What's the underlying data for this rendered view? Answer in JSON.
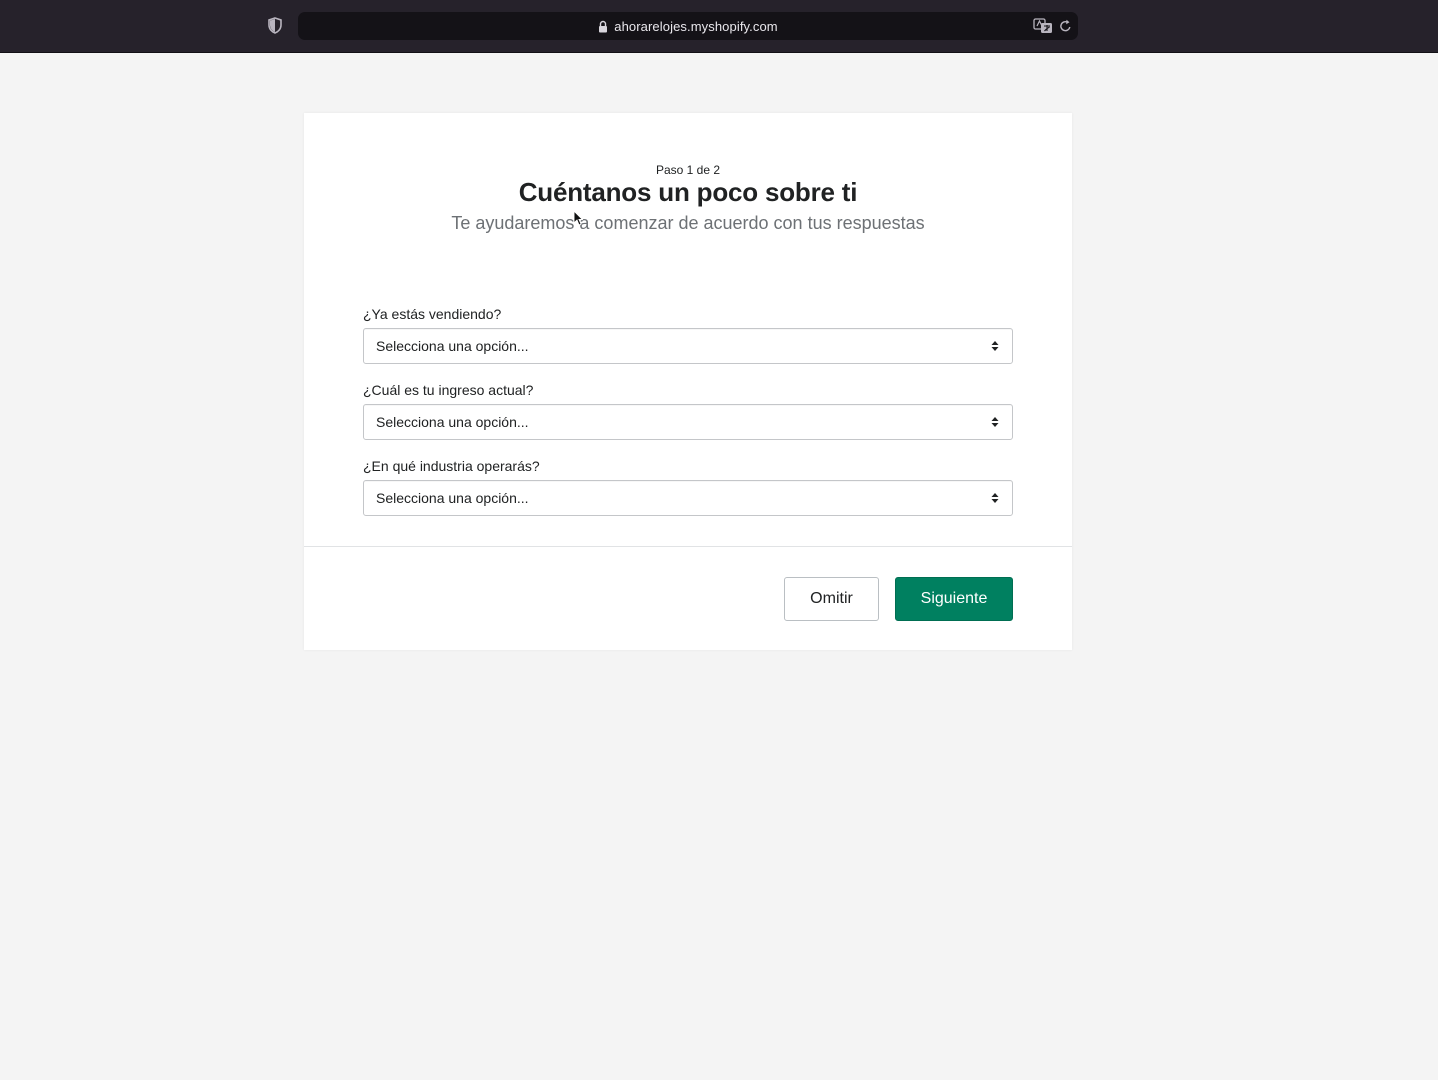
{
  "browser": {
    "url": "ahorarelojes.myshopify.com",
    "icons": [
      "shield-icon",
      "lock-icon",
      "translate-icon",
      "reload-icon"
    ]
  },
  "form": {
    "step": "Paso 1 de 2",
    "title": "Cuéntanos un poco sobre ti",
    "subtitle": "Te ayudaremos a comenzar de acuerdo con tus respuestas",
    "fields": [
      {
        "label": "¿Ya estás vendiendo?",
        "value": "Selecciona una opción..."
      },
      {
        "label": "¿Cuál es tu ingreso actual?",
        "value": "Selecciona una opción..."
      },
      {
        "label": "¿En qué industria operarás?",
        "value": "Selecciona una opción..."
      }
    ],
    "skip_label": "Omitir",
    "next_label": "Siguiente"
  },
  "colors": {
    "primary": "#008060",
    "toolbar": "#26222b",
    "background": "#f4f4f4"
  }
}
